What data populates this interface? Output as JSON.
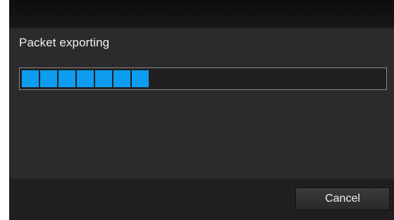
{
  "dialog": {
    "message": "Packet exporting",
    "progress": {
      "filled_blocks": 7,
      "color": "#0d9cf0"
    },
    "footer": {
      "cancel_label": "Cancel"
    }
  }
}
